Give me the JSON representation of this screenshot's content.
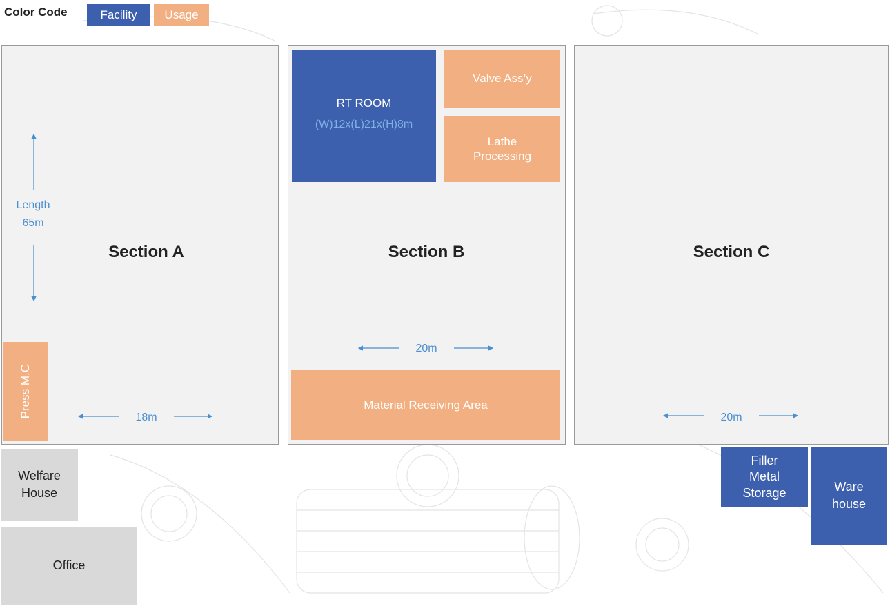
{
  "legend": {
    "title": "Color Code",
    "facility": "Facility",
    "usage": "Usage"
  },
  "colors": {
    "facility": "#3c5fae",
    "usage": "#f2af81",
    "gray": "#d9d9d9",
    "dimension": "#4a8fd0"
  },
  "sections": {
    "a": {
      "title": "Section A",
      "length_label": "Length",
      "length_value": "65m",
      "width": "18m",
      "press": "Press M.C"
    },
    "b": {
      "title": "Section B",
      "width": "20m",
      "rt_room": "RT ROOM",
      "rt_dims": "(W)12x(L)21x(H)8m",
      "valve": "Valve Ass’y",
      "lathe_line1": "Lathe",
      "lathe_line2": "Processing",
      "material": "Material Receiving Area"
    },
    "c": {
      "title": "Section C",
      "width": "20m"
    }
  },
  "outbuildings": {
    "welfare_line1": "Welfare",
    "welfare_line2": "House",
    "office": "Office",
    "filler_line1": "Filler",
    "filler_line2": "Metal",
    "filler_line3": "Storage",
    "ware_line1": "Ware",
    "ware_line2": "house"
  }
}
